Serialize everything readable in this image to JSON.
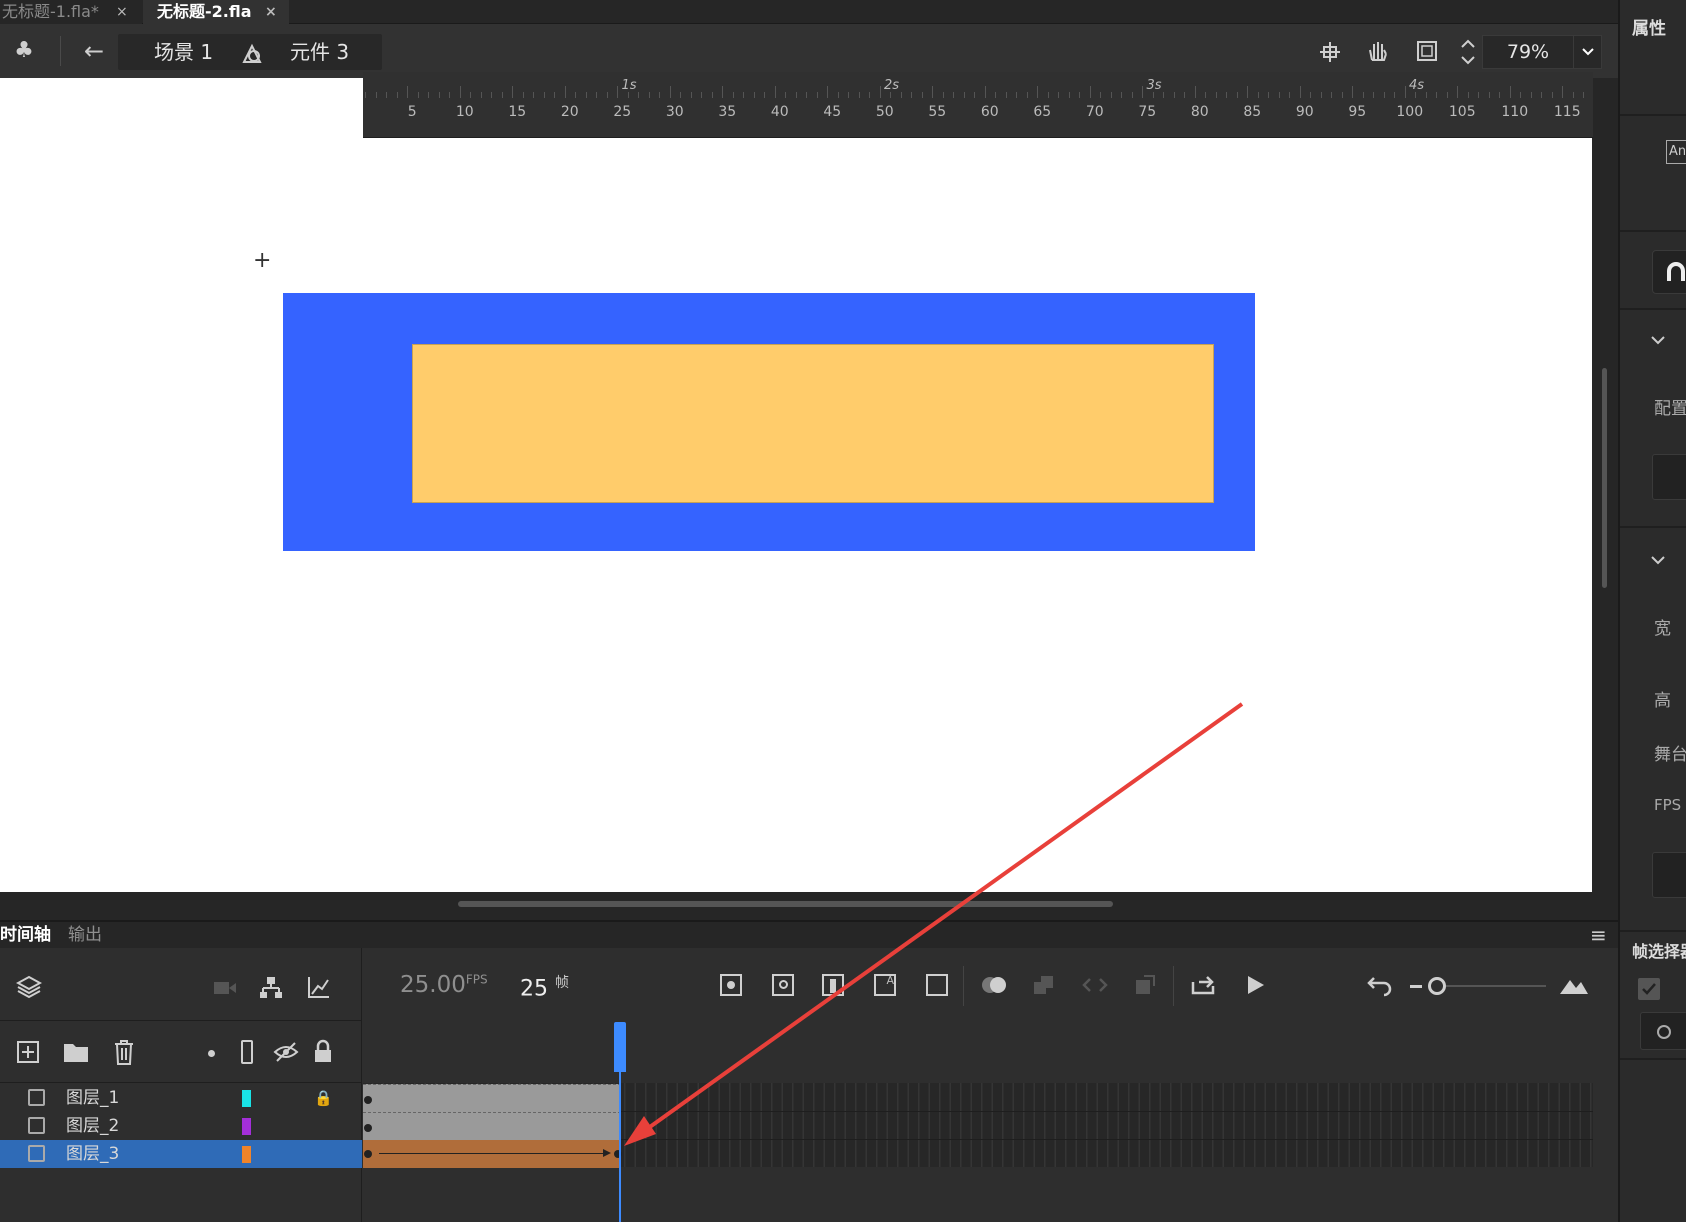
{
  "tabs": [
    {
      "label": "无标题-1.fla*",
      "close": "×"
    },
    {
      "label": "无标题-2.fla",
      "close": "×"
    }
  ],
  "toolbar": {
    "back_icon": "←",
    "scene_label": "场景 1",
    "symbol_label": "元件 3",
    "zoom_value": "79%",
    "zoom_dropdown": "⌄"
  },
  "right_panel": {
    "title": "属性",
    "an_badge": "An",
    "config_label": "配置",
    "width_label": "宽",
    "height_label": "高",
    "stage_label": "舞台",
    "fps_label": "FPS",
    "frame_picker_title": "帧选择器",
    "chevron": "⌄"
  },
  "timeline": {
    "tab_timeline": "时间轴",
    "tab_output": "输出",
    "menu_icon": "≡",
    "fps_value": "25.00",
    "fps_unit": "FPS",
    "frame_value": "25",
    "frame_unit": "帧",
    "layers": [
      {
        "name": "图层_1",
        "color": "#19e3e6",
        "locked": true
      },
      {
        "name": "图层_2",
        "color": "#a42fd9",
        "locked": false
      },
      {
        "name": "图层_3",
        "color": "#f0842a",
        "locked": false,
        "selected": true
      }
    ],
    "ruler_ticks": [
      "5",
      "10",
      "15",
      "20",
      "25",
      "30",
      "35",
      "40",
      "45",
      "50",
      "55",
      "60",
      "65",
      "70",
      "75",
      "80",
      "85",
      "90",
      "95",
      "100",
      "105",
      "110",
      "115"
    ],
    "seconds": [
      "1s",
      "2s",
      "3s",
      "4s"
    ]
  },
  "colors": {
    "stage": "#ffffff",
    "outer_rect": "#3563ff",
    "inner_rect": "#ffcc6b",
    "annotation_arrow": "#e8403a",
    "playhead": "#3d8bff",
    "tween": "#b06d3a"
  }
}
